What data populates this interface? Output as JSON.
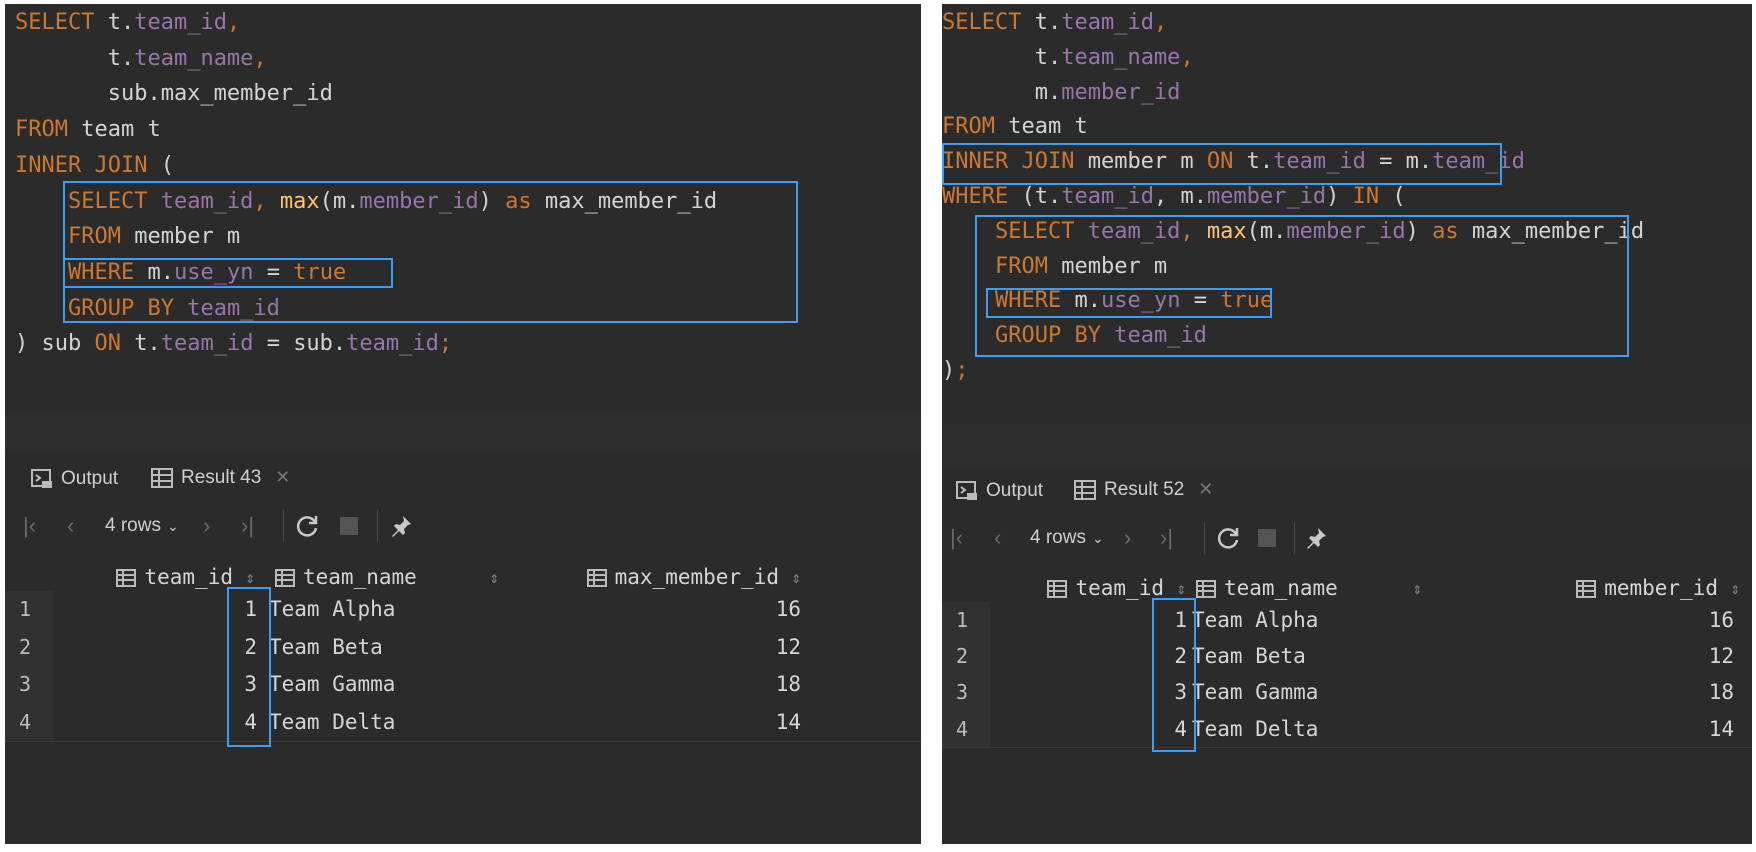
{
  "left": {
    "code": [
      [
        [
          "kw",
          "SELECT "
        ],
        [
          "pl",
          "t."
        ],
        [
          "col",
          "team_id"
        ],
        [
          "kw",
          ","
        ]
      ],
      [
        [
          "pl",
          "       t."
        ],
        [
          "col",
          "team_name"
        ],
        [
          "kw",
          ","
        ]
      ],
      [
        [
          "pl",
          "       sub.max_member_id"
        ]
      ],
      [
        [
          "kw",
          "FROM "
        ],
        [
          "pl",
          "team t"
        ]
      ],
      [
        [
          "kw",
          "INNER JOIN "
        ],
        [
          "pl",
          "("
        ]
      ],
      [
        [
          "pl",
          "    "
        ],
        [
          "kw",
          "SELECT "
        ],
        [
          "col",
          "team_id"
        ],
        [
          "kw",
          ", "
        ],
        [
          "fn",
          "max"
        ],
        [
          "pl",
          "(m."
        ],
        [
          "col",
          "member_id"
        ],
        [
          "pl",
          ") "
        ],
        [
          "kw",
          "as "
        ],
        [
          "pl",
          "max_member_id"
        ]
      ],
      [
        [
          "pl",
          "    "
        ],
        [
          "kw",
          "FROM "
        ],
        [
          "pl",
          "member m"
        ]
      ],
      [
        [
          "pl",
          "    "
        ],
        [
          "kw",
          "WHERE "
        ],
        [
          "pl",
          "m."
        ],
        [
          "col",
          "use_yn"
        ],
        [
          "pl",
          " = "
        ],
        [
          "kw",
          "true"
        ]
      ],
      [
        [
          "pl",
          "    "
        ],
        [
          "kw",
          "GROUP BY "
        ],
        [
          "col",
          "team_id"
        ]
      ],
      [
        [
          "pl",
          ") sub "
        ],
        [
          "kw",
          "ON "
        ],
        [
          "pl",
          "t."
        ],
        [
          "col",
          "team_id"
        ],
        [
          "pl",
          " = sub."
        ],
        [
          "col",
          "team_id"
        ],
        [
          "kw",
          ";"
        ]
      ]
    ],
    "tabs": {
      "output": "Output",
      "result": "Result 43"
    },
    "rows_label": "4 rows",
    "columns": [
      "team_id",
      "team_name",
      "max_member_id"
    ],
    "rows": [
      {
        "n": "1",
        "team_id": "1",
        "team_name": "Team Alpha",
        "value": "16"
      },
      {
        "n": "2",
        "team_id": "2",
        "team_name": "Team Beta",
        "value": "12"
      },
      {
        "n": "3",
        "team_id": "3",
        "team_name": "Team Gamma",
        "value": "18"
      },
      {
        "n": "4",
        "team_id": "4",
        "team_name": "Team Delta",
        "value": "14"
      }
    ]
  },
  "right": {
    "code": [
      [
        [
          "kw",
          "SELECT "
        ],
        [
          "pl",
          "t."
        ],
        [
          "col",
          "team_id"
        ],
        [
          "kw",
          ","
        ]
      ],
      [
        [
          "pl",
          "       t."
        ],
        [
          "col",
          "team_name"
        ],
        [
          "kw",
          ","
        ]
      ],
      [
        [
          "pl",
          "       m."
        ],
        [
          "col",
          "member_id"
        ]
      ],
      [
        [
          "kw",
          "FROM "
        ],
        [
          "pl",
          "team t"
        ]
      ],
      [
        [
          "kw",
          "INNER JOIN "
        ],
        [
          "pl",
          "member m "
        ],
        [
          "kw",
          "ON "
        ],
        [
          "pl",
          "t."
        ],
        [
          "col",
          "team_id"
        ],
        [
          "pl",
          " = m."
        ],
        [
          "col",
          "team_id"
        ]
      ],
      [
        [
          "kw",
          "WHERE "
        ],
        [
          "pl",
          "(t."
        ],
        [
          "col",
          "team_id"
        ],
        [
          "pl",
          ", m."
        ],
        [
          "col",
          "member_id"
        ],
        [
          "pl",
          ") "
        ],
        [
          "kw",
          "IN "
        ],
        [
          "pl",
          "("
        ]
      ],
      [
        [
          "pl",
          "    "
        ],
        [
          "kw",
          "SELECT "
        ],
        [
          "col",
          "team_id"
        ],
        [
          "kw",
          ", "
        ],
        [
          "fn",
          "max"
        ],
        [
          "pl",
          "(m."
        ],
        [
          "col",
          "member_id"
        ],
        [
          "pl",
          ") "
        ],
        [
          "kw",
          "as "
        ],
        [
          "pl",
          "max_member_id"
        ]
      ],
      [
        [
          "pl",
          "    "
        ],
        [
          "kw",
          "FROM "
        ],
        [
          "pl",
          "member m"
        ]
      ],
      [
        [
          "pl",
          "    "
        ],
        [
          "kw",
          "WHERE "
        ],
        [
          "pl",
          "m."
        ],
        [
          "col",
          "use_yn"
        ],
        [
          "pl",
          " = "
        ],
        [
          "kw",
          "true"
        ]
      ],
      [
        [
          "pl",
          "    "
        ],
        [
          "kw",
          "GROUP BY "
        ],
        [
          "col",
          "team_id"
        ]
      ],
      [
        [
          "pl",
          ")"
        ],
        [
          "kw",
          ";"
        ]
      ]
    ],
    "tabs": {
      "output": "Output",
      "result": "Result 52"
    },
    "rows_label": "4 rows",
    "columns": [
      "team_id",
      "team_name",
      "member_id"
    ],
    "rows": [
      {
        "n": "1",
        "team_id": "1",
        "team_name": "Team Alpha",
        "value": "16"
      },
      {
        "n": "2",
        "team_id": "2",
        "team_name": "Team Beta",
        "value": "12"
      },
      {
        "n": "3",
        "team_id": "3",
        "team_name": "Team Gamma",
        "value": "18"
      },
      {
        "n": "4",
        "team_id": "4",
        "team_name": "Team Delta",
        "value": "14"
      }
    ]
  },
  "colors": {
    "highlight": "#3d9df2",
    "keyword": "#cc7832",
    "column": "#9876aa",
    "function": "#ffc66d",
    "background": "#2b2b2b"
  },
  "icons": [
    "output-console-icon",
    "result-table-icon",
    "first-page-icon",
    "prev-page-icon",
    "chevron-down-icon",
    "next-page-icon",
    "last-page-icon",
    "refresh-icon",
    "stop-icon",
    "pin-icon",
    "column-table-icon",
    "sort-icon",
    "fold-icon"
  ]
}
